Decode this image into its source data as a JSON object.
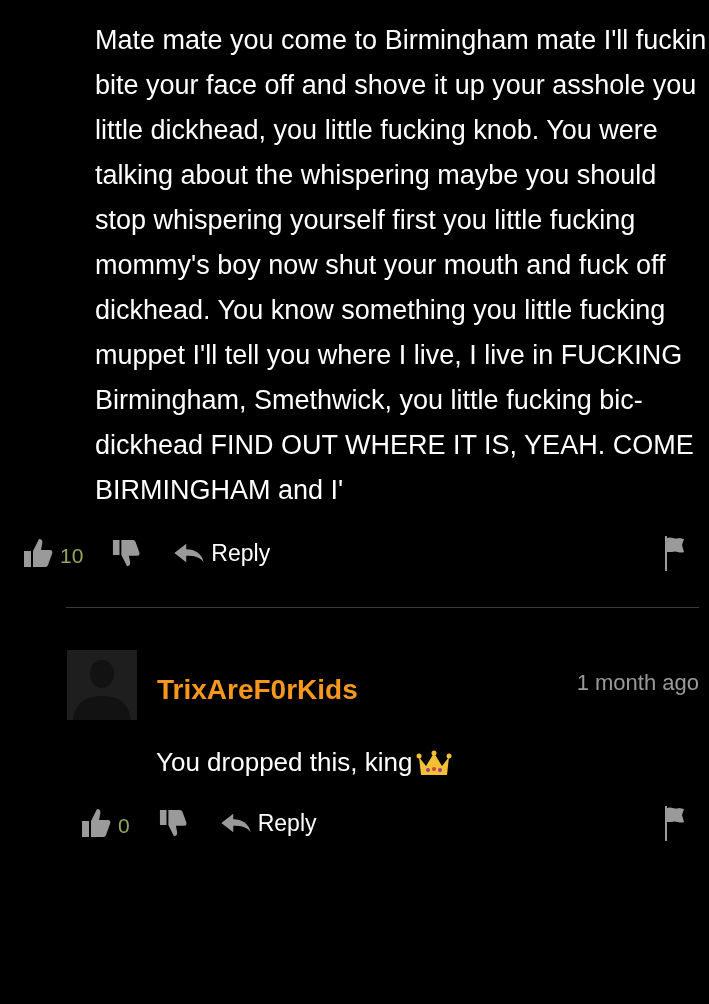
{
  "comment": {
    "text": "Mate mate you come to Birmingham mate I'll fuckin bite your face off and shove it up your asshole you little dickhead, you little fucking knob. You were talking about the whispering maybe you should stop whispering yourself first you little fucking mommy's boy now shut your mouth and fuck off dickhead. You know something you little fucking muppet I'll tell you where I live, I live in FUCKING Birmingham, Smethwick, you little fucking bic-dickhead FIND OUT WHERE IT IS, YEAH. COME BIRMINGHAM and I'",
    "likes": "10",
    "reply_label": "Reply"
  },
  "reply": {
    "author": "TrixAreF0rKids",
    "time": "1 month ago",
    "text": "You dropped this, king",
    "likes": "0",
    "reply_label": "Reply"
  }
}
